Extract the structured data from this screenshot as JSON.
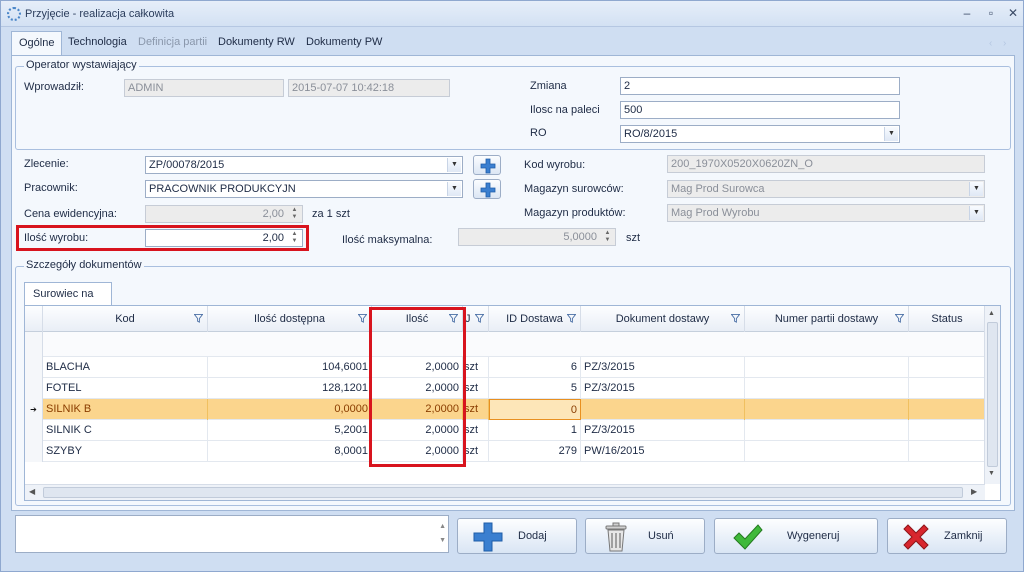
{
  "window": {
    "title": "Przyjęcie - realizacja całkowita"
  },
  "tabs": [
    {
      "label": "Ogólne",
      "state": "active"
    },
    {
      "label": "Technologia",
      "state": "normal"
    },
    {
      "label": "Definicja partii",
      "state": "disabled"
    },
    {
      "label": "Dokumenty RW",
      "state": "normal"
    },
    {
      "label": "Dokumenty PW",
      "state": "normal"
    }
  ],
  "operator": {
    "legend": "Operator wystawiający",
    "wprowadzil_label": "Wprowadził:",
    "wprowadzil_value": "ADMIN",
    "date_value": "2015-07-07 10:42:18",
    "zmiana_label": "Zmiana",
    "zmiana_value": "2",
    "ilosc_palecie_label": "Ilosc na paleci",
    "ilosc_palecie_value": "500",
    "ro_label": "RO",
    "ro_value": "RO/8/2015"
  },
  "form": {
    "zlecenie_label": "Zlecenie:",
    "zlecenie_value": "ZP/00078/2015",
    "pracownik_label": "Pracownik:",
    "pracownik_value": "PRACOWNIK PRODUKCYJN",
    "cena_label": "Cena ewidencyjna:",
    "cena_value": "2,00",
    "cena_suffix": "za 1 szt",
    "ilosc_wyrobu_label": "Ilość wyrobu:",
    "ilosc_wyrobu_value": "2,00",
    "ilosc_max_label": "Ilość maksymalna:",
    "ilosc_max_value": "5,0000",
    "ilosc_max_suffix": "szt",
    "kod_wyrobu_label": "Kod wyrobu:",
    "kod_wyrobu_value": "200_1970X0520X0620ZN_O",
    "mag_surowcow_label": "Magazyn surowców:",
    "mag_surowcow_value": "Mag Prod Surowca",
    "mag_produktow_label": "Magazyn produktów:",
    "mag_produktow_value": "Mag Prod Wyrobu"
  },
  "details": {
    "legend": "Szczegóły dokumentów",
    "subtab": "Surowiec na RW",
    "columns": [
      "Kod",
      "Ilość dostępna",
      "Ilość",
      "J",
      "ID Dostawa",
      "Dokument dostawy",
      "Numer partii dostawy",
      "Status"
    ],
    "rows": [
      {
        "kod": "BLACHA",
        "dostepna": "104,6001",
        "ilosc": "2,0000",
        "j": "szt",
        "id": "6",
        "dok": "PZ/3/2015",
        "partia": "",
        "status": ""
      },
      {
        "kod": "FOTEL",
        "dostepna": "128,1201",
        "ilosc": "2,0000",
        "j": "szt",
        "id": "5",
        "dok": "PZ/3/2015",
        "partia": "",
        "status": ""
      },
      {
        "kod": "SILNIK B",
        "dostepna": "0,0000",
        "ilosc": "2,0000",
        "j": "szt",
        "id": "0",
        "dok": "",
        "partia": "",
        "status": ""
      },
      {
        "kod": "SILNIK C",
        "dostepna": "5,2001",
        "ilosc": "2,0000",
        "j": "szt",
        "id": "1",
        "dok": "PZ/3/2015",
        "partia": "",
        "status": ""
      },
      {
        "kod": "SZYBY",
        "dostepna": "8,0001",
        "ilosc": "2,0000",
        "j": "szt",
        "id": "279",
        "dok": "PW/16/2015",
        "partia": "",
        "status": ""
      }
    ]
  },
  "buttons": {
    "dodaj": "Dodaj",
    "usun": "Usuń",
    "wygeneruj": "Wygeneruj",
    "zamknij": "Zamknij"
  },
  "colors": {
    "highlight": "#d8141e",
    "selected_row": "#fbd58d",
    "accent": "#3a7fd0"
  }
}
